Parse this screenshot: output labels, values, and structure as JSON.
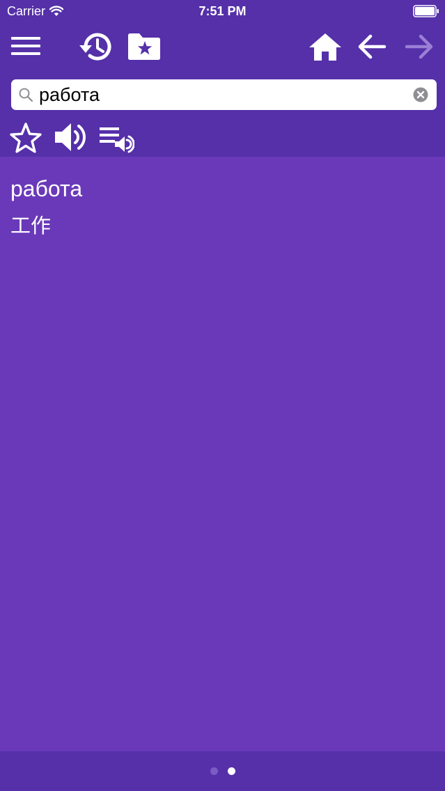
{
  "status_bar": {
    "carrier": "Carrier",
    "time": "7:51 PM",
    "icons": [
      "wifi-icon",
      "battery-icon"
    ]
  },
  "toolbar": {
    "left_icons": [
      "menu-icon",
      "history-icon",
      "favorites-folder-icon"
    ],
    "right_icons": [
      "home-icon",
      "back-arrow-icon",
      "forward-arrow-icon"
    ],
    "forward_enabled": false
  },
  "search": {
    "value": "работа",
    "placeholder": "",
    "icons": [
      "search-icon",
      "clear-icon"
    ]
  },
  "actions": {
    "icons": [
      "star-icon",
      "speaker-icon",
      "playlist-speaker-icon"
    ]
  },
  "entry": {
    "word": "работа",
    "translation": "工作"
  },
  "pager": {
    "total": 2,
    "current": 2
  },
  "colors": {
    "header_bg": "#5530a9",
    "content_bg": "#6a39b9",
    "icon": "#ffffff",
    "icon_disabled": "#9b7fd6",
    "dot_inactive": "#7a5cc4",
    "dot_active": "#ffffff"
  }
}
